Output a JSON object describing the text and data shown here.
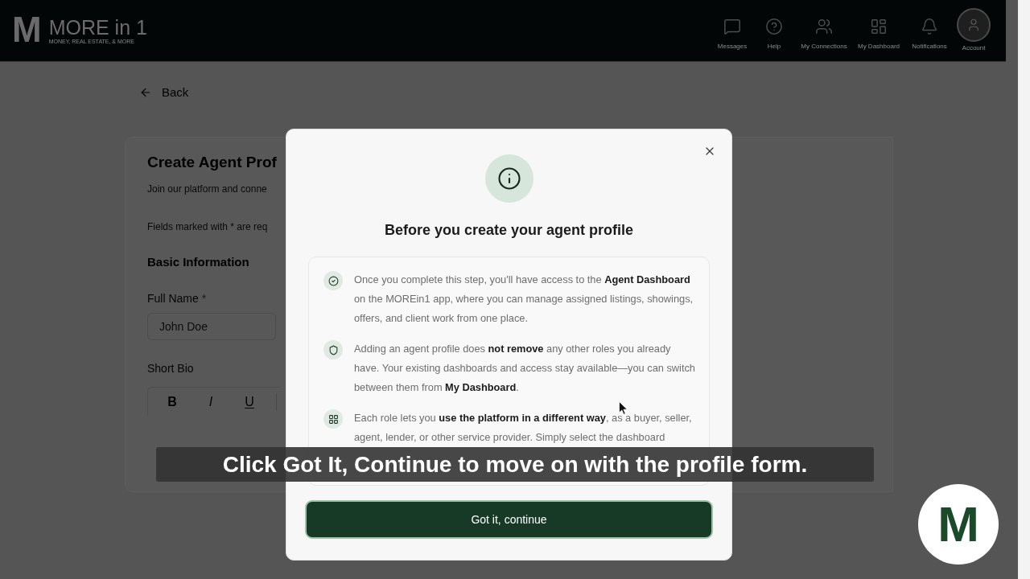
{
  "header": {
    "brand": {
      "mark": "M",
      "name": "MORE in 1",
      "tagline": "MONEY, REAL ESTATE, & MORE"
    },
    "nav": [
      {
        "label": "Messages",
        "kind": "icon"
      },
      {
        "label": "Help",
        "kind": "icon"
      },
      {
        "label": "My Connections",
        "kind": "icon"
      },
      {
        "label": "My Dashboard",
        "kind": "icon"
      },
      {
        "label": "Notifications",
        "kind": "icon"
      },
      {
        "label": "Account",
        "kind": "avatar"
      }
    ]
  },
  "page": {
    "back": "Back",
    "form": {
      "title": "Create Agent Prof",
      "subtitle": "Join our platform and conne",
      "note": "Fields marked with * are req",
      "section": "Basic Information",
      "fields": [
        {
          "label": "Full Name",
          "required_mark": "*",
          "kind": "text",
          "placeholder": "John Doe"
        },
        {
          "label": "Short Bio",
          "kind": "rich_text",
          "toolbar": [
            {
              "label": "B",
              "kind": "bold"
            },
            {
              "label": "I",
              "kind": "italic"
            },
            {
              "label": "U",
              "kind": "underline"
            }
          ]
        }
      ]
    }
  },
  "modal": {
    "title": "Before you create your agent profile",
    "items": [
      {
        "text": "Once you complete this step, you'll have access to the **Agent Dashboard** on the MOREin1 app, where you can manage assigned listings, showings, offers, and client work from one place."
      },
      {
        "text": "Adding an agent profile does **not remove** any other roles you already have. Your existing dashboards and access stay available—you can switch between them from **My Dashboard**."
      },
      {
        "text": "Each role lets you **use the platform in a different way**, as a buyer, seller, agent, lender, or other service provider. Simply select the dashboard"
      }
    ],
    "button": "Got it, continue"
  },
  "caption": "Click Got It, Continue to move on with the profile form.",
  "corner_logo": {
    "mark": "M"
  }
}
